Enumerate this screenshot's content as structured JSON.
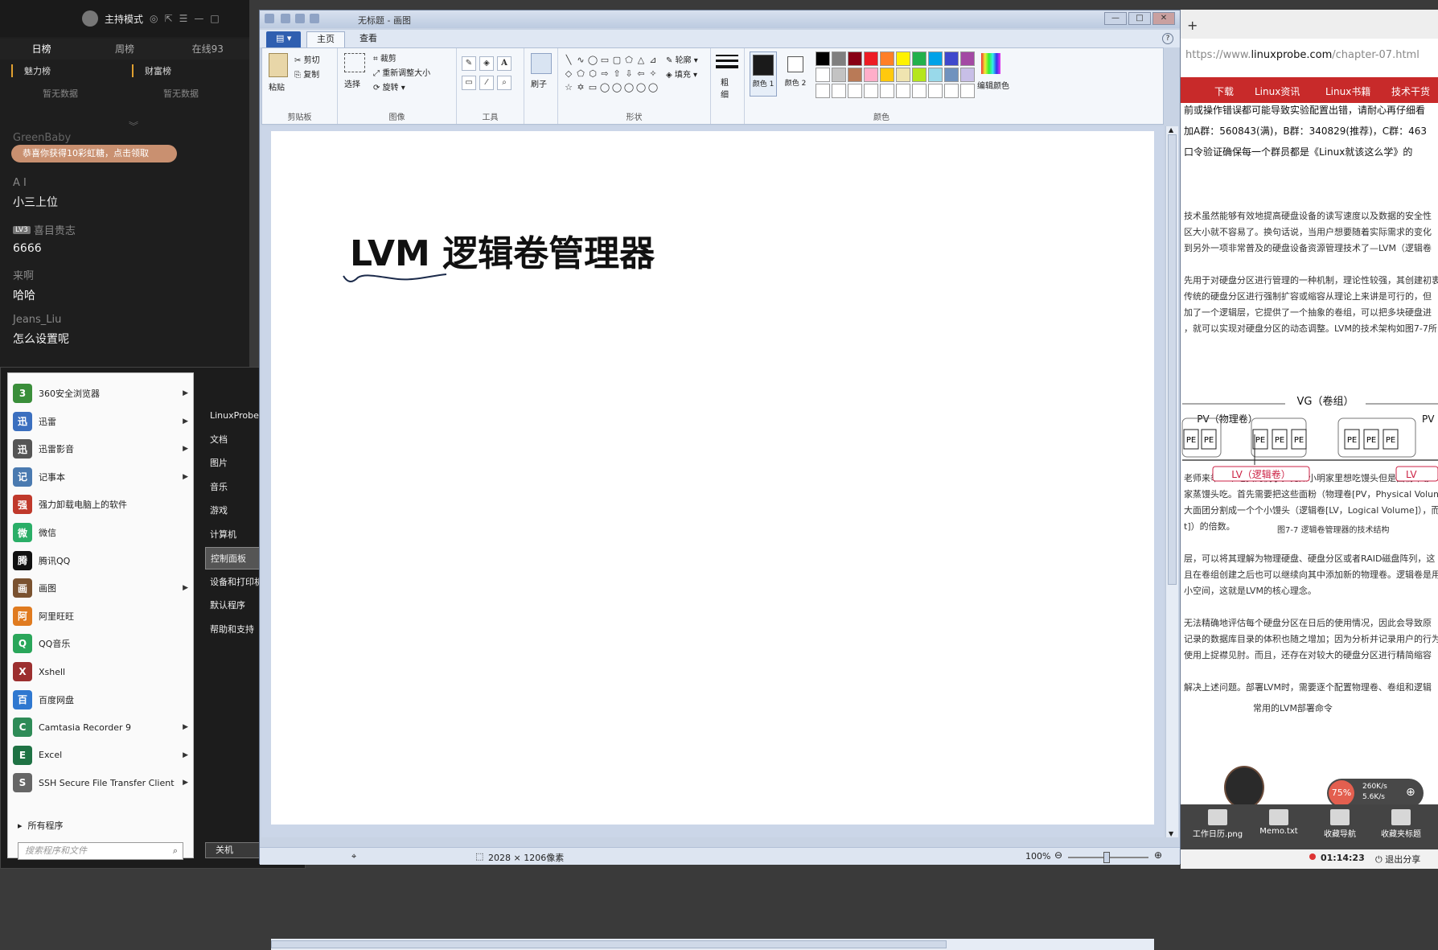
{
  "chat": {
    "mode_label": "主持模式",
    "tabs": [
      "日榜",
      "周榜",
      "在线93"
    ],
    "rank_titles": [
      "魅力榜",
      "财富榜"
    ],
    "rank_empty": "暂无数据",
    "faded_name": "GreenBaby",
    "gift_banner": "恭喜你获得10彩虹糖，点击领取",
    "messages": [
      {
        "name": "A I",
        "level": "",
        "text": "小三上位"
      },
      {
        "name": "喜目贵志",
        "level": "LV3",
        "text": "6666"
      },
      {
        "name": "来啊",
        "level": "",
        "text": "哈哈"
      },
      {
        "name": "Jeans_Liu",
        "level": "",
        "text": "怎么设置呢"
      }
    ]
  },
  "start_menu": {
    "programs": [
      {
        "label": "360安全浏览器",
        "icon": "browser-360-icon",
        "color": "#3a8e3a",
        "arrow": true
      },
      {
        "label": "迅雷",
        "icon": "thunder-icon",
        "color": "#3b6fbf",
        "arrow": true
      },
      {
        "label": "迅雷影音",
        "icon": "thunder-player-icon",
        "color": "#555",
        "arrow": true
      },
      {
        "label": "记事本",
        "icon": "notepad-icon",
        "color": "#4a7ab0",
        "arrow": true
      },
      {
        "label": "强力卸载电脑上的软件",
        "icon": "uninstall-icon",
        "color": "#c0392b",
        "arrow": false
      },
      {
        "label": "微信",
        "icon": "wechat-icon",
        "color": "#2aae67",
        "arrow": false
      },
      {
        "label": "腾讯QQ",
        "icon": "qq-icon",
        "color": "#111",
        "arrow": false
      },
      {
        "label": "画图",
        "icon": "paint-icon",
        "color": "#7a5230",
        "arrow": true
      },
      {
        "label": "阿里旺旺",
        "icon": "wangwang-icon",
        "color": "#e07b20",
        "arrow": false
      },
      {
        "label": "QQ音乐",
        "icon": "qqmusic-icon",
        "color": "#2aa65a",
        "arrow": false
      },
      {
        "label": "Xshell",
        "icon": "xshell-icon",
        "color": "#9c2f2f",
        "arrow": false
      },
      {
        "label": "百度网盘",
        "icon": "baidu-netdisk-icon",
        "color": "#2f78d0",
        "arrow": false
      },
      {
        "label": "Camtasia Recorder 9",
        "icon": "camtasia-icon",
        "color": "#2e8b57",
        "arrow": true
      },
      {
        "label": "Excel",
        "icon": "excel-icon",
        "color": "#1f7244",
        "arrow": true
      },
      {
        "label": "SSH Secure File Transfer Client",
        "icon": "ssh-icon",
        "color": "#666",
        "arrow": true
      }
    ],
    "all_programs": "所有程序",
    "search_placeholder": "搜索程序和文件",
    "right_items": [
      "LinuxProbe",
      "文档",
      "图片",
      "音乐",
      "游戏",
      "计算机",
      "控制面板",
      "设备和打印机",
      "默认程序",
      "帮助和支持"
    ],
    "highlight_index": 6,
    "shutdown": "关机"
  },
  "paint": {
    "title": "无标题 - 画图",
    "tabs": {
      "home": "主页",
      "view": "查看"
    },
    "groups": {
      "clipboard": "剪贴板",
      "image": "图像",
      "tools": "工具",
      "shapes": "形状",
      "colors": "颜色"
    },
    "buttons": {
      "paste": "粘贴",
      "cut": "剪切",
      "copy": "复制",
      "select": "选择",
      "crop": "裁剪",
      "resize": "重新调整大小",
      "rotate": "旋转",
      "brushes": "刷子",
      "outline": "轮廓",
      "fill": "填充",
      "size": "粗细",
      "color1": "颜色 1",
      "color2": "颜色 2",
      "edit_colors": "编辑颜色"
    },
    "palette": [
      "#000000",
      "#7f7f7f",
      "#880015",
      "#ed1c24",
      "#ff7f27",
      "#fff200",
      "#22b14c",
      "#00a2e8",
      "#3f48cc",
      "#a349a4",
      "#ffffff",
      "#c3c3c3",
      "#b97a57",
      "#ffaec9",
      "#ffc90e",
      "#efe4b0",
      "#b5e61d",
      "#99d9ea",
      "#7092be",
      "#c8bfe7"
    ],
    "color1": "#1a1a1a",
    "color2": "#ffffff",
    "canvas_heading": "LVM 逻辑卷管理器",
    "status": {
      "size": "2028 × 1206像素",
      "zoom": "100%"
    }
  },
  "browser": {
    "url_prefix": "https://www.",
    "url_domain": "linuxprobe.com",
    "url_path": "/chapter-07.html",
    "nav": [
      "下载",
      "Linux资讯",
      "Linux书籍",
      "技术干货"
    ],
    "lines_top": [
      "前或操作错误都可能导致实验配置出错，请耐心再仔细看",
      "加A群：560843(满)，B群：340829(推荐)，C群：463",
      "口令验证确保每一个群员都是《Linux就该这么学》的"
    ],
    "lines_mid": [
      "技术虽然能够有效地提高硬盘设备的读写速度以及数据的安全性",
      "区大小就不容易了。换句话说，当用户想要随着实际需求的变化",
      "到另外一项非常普及的硬盘设备资源管理技术了—LVM（逻辑卷",
      "",
      "先用于对硬盘分区进行管理的一种机制，理论性较强，其创建初衷",
      "传统的硬盘分区进行强制扩容或缩容从理论上来讲是可行的，但",
      "加了一个逻辑层，它提供了一个抽象的卷组，可以把多块硬盘进",
      "，就可以实现对硬盘分区的动态调整。LVM的技术架构如图7-7所"
    ],
    "diagram": {
      "vg": "VG（卷组）",
      "pv": "PV（物理卷）",
      "pv_short": "PV（",
      "pe": "PE",
      "lv": "LV（逻辑卷）",
      "lv_short": "LV"
    },
    "figure_caption": "图7-7  逻辑卷管理器的技术结构",
    "lines_bottom": [
      "老师来举一个吃货的例子。比如小明家里想吃馒头但是面粉不够",
      "家蒸馒头吃。首先需要把这些面粉（物理卷[PV，Physical Volum",
      "大面团分割成一个个小馒头（逻辑卷[LV，Logical Volume]），而",
      "t]）的倍数。",
      "",
      "层，可以将其理解为物理硬盘、硬盘分区或者RAID磁盘阵列，这",
      "且在卷组创建之后也可以继续向其中添加新的物理卷。逻辑卷是用",
      "小空间，这就是LVM的核心理念。",
      "",
      "无法精确地评估每个硬盘分区在日后的使用情况，因此会导致原",
      "记录的数据库目录的体积也随之增加；因为分析并记录用户的行为",
      "使用上捉襟见肘。而且，还存在对较大的硬盘分区进行精简缩容",
      "",
      "解决上述问题。部署LVM时，需要逐个配置物理卷、卷组和逻辑"
    ],
    "table_title": "常用的LVM部署命令"
  },
  "tray": {
    "percent": "75%",
    "up_speed": "260K/s",
    "down_speed": "5.6K/s",
    "desktop_items": [
      "工作日历.png",
      "Memo.txt",
      "收藏导航",
      "收藏夹标题"
    ],
    "time": "01:14:23",
    "exit_share": "退出分享"
  }
}
